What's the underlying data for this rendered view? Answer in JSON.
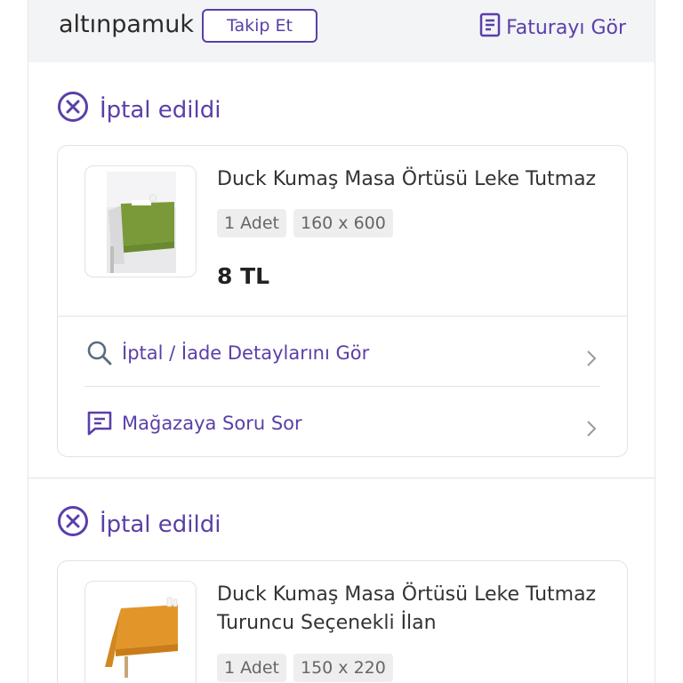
{
  "header": {
    "shop_name": "altınpamuk",
    "follow_label": "Takip Et",
    "invoice_label": "Faturayı Gör"
  },
  "orders": [
    {
      "status": "İptal edildi",
      "product_title": "Duck Kumaş Masa Örtüsü Leke Tutmaz",
      "quantity": "1 Adet",
      "size": "160 x 600",
      "price": "8 TL",
      "actions": [
        {
          "label": "İptal / İade Detaylarını Gör",
          "icon": "search-icon"
        },
        {
          "label": "Mağazaya Soru Sor",
          "icon": "message-icon"
        }
      ]
    },
    {
      "status": "İptal edildi",
      "product_title": "Duck Kumaş Masa Örtüsü Leke Tutmaz Turuncu Seçenekli İlan",
      "quantity": "1 Adet",
      "size": "150 x 220"
    }
  ],
  "colors": {
    "accent": "#5b3fa8",
    "header_bg": "#f3f4f6"
  }
}
